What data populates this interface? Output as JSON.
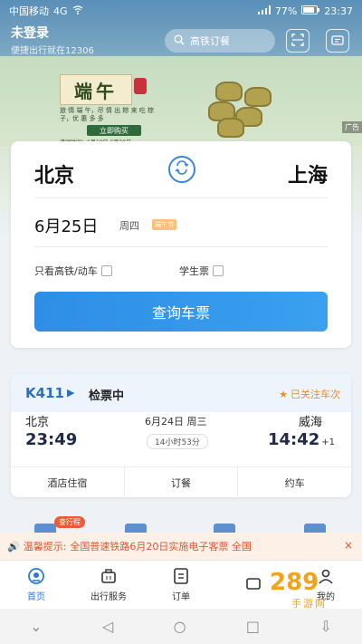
{
  "status_bar": {
    "carrier": "中国移动",
    "signal": "4G",
    "battery": "77%",
    "time": "23:37"
  },
  "header": {
    "login_title": "未登录",
    "login_subtitle": "便捷出行就在12306",
    "search_placeholder": "高铁订餐"
  },
  "banner": {
    "title": "端午",
    "desc": "旅 情 端 午，尽 情 出 粽 来 吃 棕 子，优 惠 多 多",
    "button": "立即购买",
    "footer": "活动时间：6月18日-6月30日",
    "ad_label": "广告"
  },
  "booking": {
    "from_city": "北京",
    "to_city": "上海",
    "date": "6月25日",
    "weekday": "周四",
    "date_badge": "端午节",
    "option_highspeed": "只看高铁/动车",
    "option_student": "学生票",
    "query_button": "查询车票"
  },
  "trip": {
    "train_no": "K411",
    "status": "检票中",
    "follow_label": "已关注车次",
    "dep_city": "北京",
    "arr_city": "威海",
    "dep_time": "23:49",
    "arr_time": "14:42",
    "arr_plus": "+1",
    "date": "6月24日 周三",
    "duration": "14小时53分",
    "services": [
      "酒店住宿",
      "订餐",
      "约车"
    ]
  },
  "peek": {
    "badge": "查行程"
  },
  "notice": {
    "prefix": "温馨提示:",
    "text": "全国普速铁路6月20日实施电子客票  全国",
    "close": "×"
  },
  "tabbar": {
    "tabs": [
      "首页",
      "出行服务",
      "订单",
      "",
      "我的"
    ]
  },
  "watermark": {
    "text": "289",
    "sub": "手游网"
  },
  "colors": {
    "accent": "#2b7bd3",
    "query_button": "#2e8ee6",
    "warning": "#e0562f",
    "follow": "#f08c1e"
  }
}
